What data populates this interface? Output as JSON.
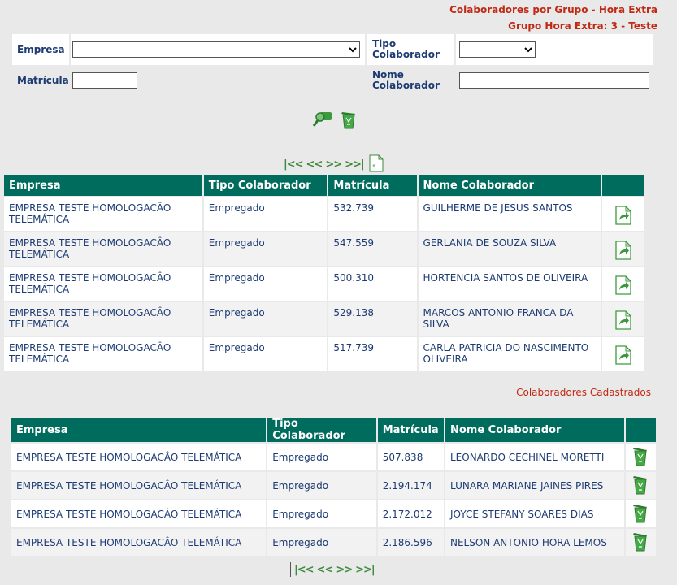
{
  "header": {
    "title": "Colaboradores por Grupo - Hora Extra",
    "subtitle": "Grupo Hora Extra: 3 - Teste"
  },
  "filters": {
    "empresa_label": "Empresa",
    "empresa_value": "",
    "tipo_label": "Tipo Colaborador",
    "tipo_value": "",
    "matricula_label": "Matrícula",
    "matricula_value": "",
    "nome_label": "Nome Colaborador",
    "nome_value": ""
  },
  "icons": {
    "search": "search-icon",
    "clear": "trash-icon",
    "export": "export-icon",
    "add": "add-icon"
  },
  "pager": [
    "|<<",
    "<<",
    ">>",
    ">>|"
  ],
  "available_table": {
    "headers": [
      "Empresa",
      "Tipo Colaborador",
      "Matrícula",
      "Nome Colaborador"
    ],
    "rows": [
      {
        "empresa": "EMPRESA TESTE HOMOLOGACÂO TELEMÁTICA",
        "tipo": "Empregado",
        "matricula": "532.739",
        "nome": "GUILHERME DE JESUS SANTOS"
      },
      {
        "empresa": "EMPRESA TESTE HOMOLOGACÂO TELEMÁTICA",
        "tipo": "Empregado",
        "matricula": "547.559",
        "nome": "GERLANIA DE SOUZA SILVA"
      },
      {
        "empresa": "EMPRESA TESTE HOMOLOGACÂO TELEMÁTICA",
        "tipo": "Empregado",
        "matricula": "500.310",
        "nome": "HORTENCIA SANTOS DE OLIVEIRA"
      },
      {
        "empresa": "EMPRESA TESTE HOMOLOGACÂO TELEMÁTICA",
        "tipo": "Empregado",
        "matricula": "529.138",
        "nome": "MARCOS ANTONIO FRANCA DA SILVA"
      },
      {
        "empresa": "EMPRESA TESTE HOMOLOGACÂO TELEMÁTICA",
        "tipo": "Empregado",
        "matricula": "517.739",
        "nome": "CARLA PATRICIA DO NASCIMENTO OLIVEIRA"
      }
    ]
  },
  "registered_section_title": "Colaboradores Cadastrados",
  "registered_table": {
    "headers": [
      "Empresa",
      "Tipo Colaborador",
      "Matrícula",
      "Nome Colaborador"
    ],
    "rows": [
      {
        "empresa": "EMPRESA TESTE HOMOLOGACÂO TELEMÁTICA",
        "tipo": "Empregado",
        "matricula": "507.838",
        "nome": "LEONARDO CECHINEL MORETTI"
      },
      {
        "empresa": "EMPRESA TESTE HOMOLOGACÂO TELEMÁTICA",
        "tipo": "Empregado",
        "matricula": "2.194.174",
        "nome": "LUNARA MARIANE JAINES PIRES"
      },
      {
        "empresa": "EMPRESA TESTE HOMOLOGACÂO TELEMÁTICA",
        "tipo": "Empregado",
        "matricula": "2.172.012",
        "nome": "JOYCE STEFANY SOARES DIAS"
      },
      {
        "empresa": "EMPRESA TESTE HOMOLOGACÂO TELEMÁTICA",
        "tipo": "Empregado",
        "matricula": "2.186.596",
        "nome": "NELSON ANTONIO HORA LEMOS"
      }
    ]
  },
  "colors": {
    "header_bg": "#006c5e",
    "title_red": "#c02a14",
    "text_blue": "#1d3b73",
    "icon_green": "#3c8a3c"
  }
}
